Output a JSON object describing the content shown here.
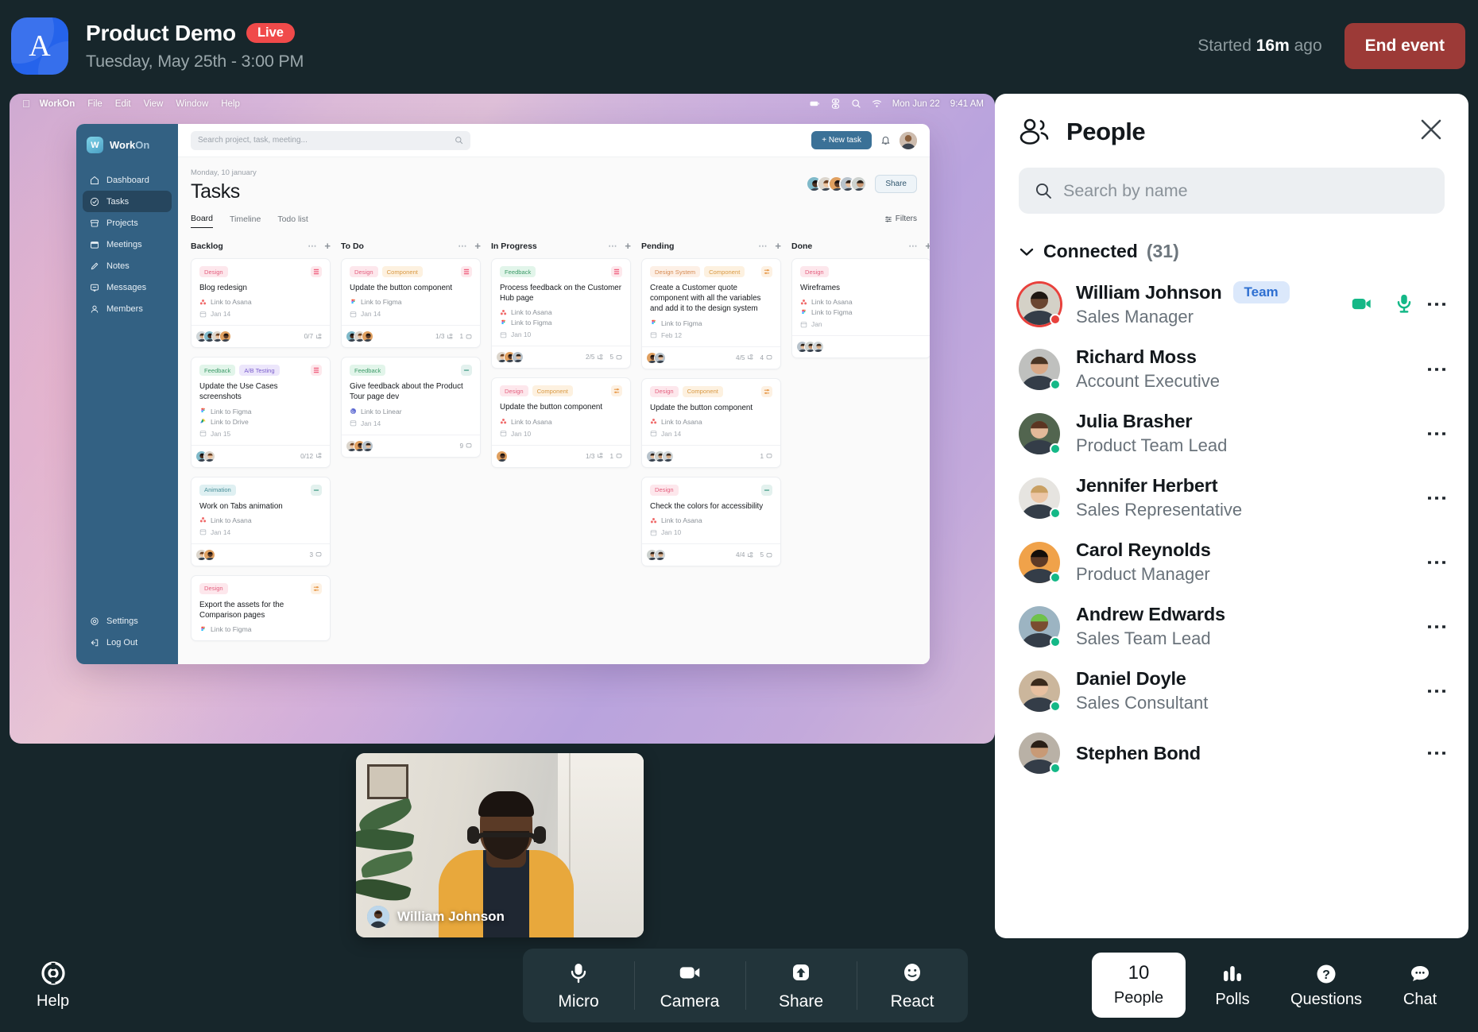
{
  "header": {
    "logo_letter": "A",
    "title": "Product Demo",
    "live_badge": "Live",
    "date": "Tuesday, May 25th - 3:00 PM",
    "started_prefix": "Started ",
    "started_value": "16m",
    "started_suffix": " ago",
    "end_event_label": "End event",
    "accent_red": "#9c3a37",
    "live_red": "#f04a4a"
  },
  "shared_screen": {
    "menubar": {
      "apple": "apple-icon",
      "app": "WorkOn",
      "items": [
        "File",
        "Edit",
        "View",
        "Window",
        "Help"
      ],
      "date": "Mon Jun 22",
      "time": "9:41 AM"
    },
    "app": {
      "brand_a": "Work",
      "brand_b": "On",
      "brand_mark": "W",
      "search_placeholder": "Search project, task, meeting...",
      "new_task_label": "+ New task",
      "nav": [
        {
          "label": "Dashboard",
          "icon": "home-icon",
          "active": false
        },
        {
          "label": "Tasks",
          "icon": "check-circle-icon",
          "active": true
        },
        {
          "label": "Projects",
          "icon": "archive-icon",
          "active": false
        },
        {
          "label": "Meetings",
          "icon": "calendar-icon",
          "active": false
        },
        {
          "label": "Notes",
          "icon": "pencil-icon",
          "active": false
        },
        {
          "label": "Messages",
          "icon": "message-icon",
          "active": false
        },
        {
          "label": "Members",
          "icon": "user-icon",
          "active": false
        }
      ],
      "nav_bottom": [
        {
          "label": "Settings",
          "icon": "gear-icon"
        },
        {
          "label": "Log Out",
          "icon": "logout-icon"
        }
      ],
      "date_line": "Monday, 10 january",
      "page_title": "Tasks",
      "share_label": "Share",
      "filters_label": "Filters",
      "tabs": [
        {
          "label": "Board",
          "active": true
        },
        {
          "label": "Timeline",
          "active": false
        },
        {
          "label": "Todo list",
          "active": false
        }
      ],
      "columns": [
        {
          "name": "Backlog",
          "cards": [
            {
              "tags": [
                {
                  "label": "Design",
                  "kind": "design"
                }
              ],
              "priority": "high",
              "title": "Blog redesign",
              "links": [
                {
                  "label": "Link to Asana",
                  "icon": "asana-icon"
                }
              ],
              "date": "Jan 14",
              "avatars": 4,
              "subtasks": "0/7",
              "comments": ""
            },
            {
              "tags": [
                {
                  "label": "Feedback",
                  "kind": "feedback"
                },
                {
                  "label": "A/B Testing",
                  "kind": "ab"
                }
              ],
              "priority": "high",
              "title": "Update the Use Cases screenshots",
              "links": [
                {
                  "label": "Link to Figma",
                  "icon": "figma-icon"
                },
                {
                  "label": "Link to Drive",
                  "icon": "drive-icon"
                }
              ],
              "date": "Jan 15",
              "avatars": 2,
              "subtasks": "0/12",
              "comments": ""
            },
            {
              "tags": [
                {
                  "label": "Animation",
                  "kind": "anim"
                }
              ],
              "priority": "low",
              "title": "Work on Tabs animation",
              "links": [
                {
                  "label": "Link to Asana",
                  "icon": "asana-icon"
                }
              ],
              "date": "Jan 14",
              "avatars": 2,
              "subtasks": "",
              "comments": "3"
            },
            {
              "tags": [
                {
                  "label": "Design",
                  "kind": "design"
                }
              ],
              "priority": "med",
              "title": "Export the assets for the Comparison pages",
              "links": [
                {
                  "label": "Link to Figma",
                  "icon": "figma-icon"
                }
              ],
              "date": "",
              "avatars": 0,
              "subtasks": "",
              "comments": ""
            }
          ]
        },
        {
          "name": "To Do",
          "cards": [
            {
              "tags": [
                {
                  "label": "Design",
                  "kind": "design"
                },
                {
                  "label": "Component",
                  "kind": "component"
                }
              ],
              "priority": "high",
              "title": "Update the button component",
              "links": [
                {
                  "label": "Link to Figma",
                  "icon": "figma-icon"
                }
              ],
              "date": "Jan 14",
              "avatars": 3,
              "subtasks": "1/3",
              "comments": "1"
            },
            {
              "tags": [
                {
                  "label": "Feedback",
                  "kind": "feedback"
                }
              ],
              "priority": "low",
              "title": "Give feedback about the Product Tour page dev",
              "links": [
                {
                  "label": "Link to Linear",
                  "icon": "linear-icon"
                }
              ],
              "date": "Jan 14",
              "avatars": 3,
              "subtasks": "",
              "comments": "9"
            }
          ]
        },
        {
          "name": "In Progress",
          "cards": [
            {
              "tags": [
                {
                  "label": "Feedback",
                  "kind": "feedback"
                }
              ],
              "priority": "high",
              "title": "Process feedback on the Customer Hub page",
              "links": [
                {
                  "label": "Link to Asana",
                  "icon": "asana-icon"
                },
                {
                  "label": "Link to Figma",
                  "icon": "figma-icon"
                }
              ],
              "date": "Jan 10",
              "avatars": 3,
              "subtasks": "2/5",
              "comments": "5"
            },
            {
              "tags": [
                {
                  "label": "Design",
                  "kind": "design"
                },
                {
                  "label": "Component",
                  "kind": "component"
                }
              ],
              "priority": "med",
              "title": "Update the button component",
              "links": [
                {
                  "label": "Link to Asana",
                  "icon": "asana-icon"
                }
              ],
              "date": "Jan 10",
              "avatars": 1,
              "subtasks": "1/3",
              "comments": "1"
            }
          ]
        },
        {
          "name": "Pending",
          "cards": [
            {
              "tags": [
                {
                  "label": "Design System",
                  "kind": "ds"
                },
                {
                  "label": "Component",
                  "kind": "component"
                }
              ],
              "priority": "med",
              "title": "Create a Customer quote component with all the variables and add it to the design system",
              "links": [
                {
                  "label": "Link to Figma",
                  "icon": "figma-icon"
                }
              ],
              "date": "Feb 12",
              "avatars": 2,
              "subtasks": "4/5",
              "comments": "4"
            },
            {
              "tags": [
                {
                  "label": "Design",
                  "kind": "design"
                },
                {
                  "label": "Component",
                  "kind": "component"
                }
              ],
              "priority": "med",
              "title": "Update the button component",
              "links": [
                {
                  "label": "Link to Asana",
                  "icon": "asana-icon"
                }
              ],
              "date": "Jan 14",
              "avatars": 3,
              "subtasks": "",
              "comments": "1"
            },
            {
              "tags": [
                {
                  "label": "Design",
                  "kind": "design"
                }
              ],
              "priority": "low",
              "title": "Check the colors for accessibility",
              "links": [
                {
                  "label": "Link to Asana",
                  "icon": "asana-icon"
                }
              ],
              "date": "Jan 10",
              "avatars": 2,
              "subtasks": "4/4",
              "comments": "5"
            }
          ]
        },
        {
          "name": "Done",
          "cards": [
            {
              "tags": [
                {
                  "label": "Design",
                  "kind": "design"
                }
              ],
              "priority": "",
              "title": "Wireframes",
              "links": [
                {
                  "label": "Link to Asana",
                  "icon": "asana-icon"
                },
                {
                  "label": "Link to Figma",
                  "icon": "figma-icon"
                }
              ],
              "date": "Jan",
              "avatars": 3,
              "subtasks": "",
              "comments": ""
            }
          ]
        }
      ]
    }
  },
  "self_video": {
    "name": "William Johnson"
  },
  "people_panel": {
    "title": "People",
    "search_placeholder": "Search by name",
    "search_value": "",
    "group_label": "Connected",
    "group_count": "(31)",
    "team_badge": "Team",
    "people": [
      {
        "name": "William Johnson",
        "role": "Sales Manager",
        "badge": "Team",
        "status": "red",
        "speaking": true,
        "camera_on": true,
        "mic_on": true,
        "skin": "#6a4631",
        "hair": "#1e1712",
        "bg": "#d4d1c7"
      },
      {
        "name": "Richard Moss",
        "role": "Account Executive",
        "badge": "",
        "status": "green",
        "speaking": false,
        "camera_on": false,
        "mic_on": false,
        "skin": "#d9a886",
        "hair": "#4a3524",
        "bg": "#bfc0be"
      },
      {
        "name": "Julia Brasher",
        "role": "Product Team Lead",
        "badge": "",
        "status": "green",
        "speaking": false,
        "camera_on": false,
        "mic_on": false,
        "skin": "#e2b999",
        "hair": "#5b3522",
        "bg": "#52654f"
      },
      {
        "name": "Jennifer Herbert",
        "role": "Sales Representative",
        "badge": "",
        "status": "green",
        "speaking": false,
        "camera_on": false,
        "mic_on": false,
        "skin": "#ecc6a6",
        "hair": "#c9a063",
        "bg": "#e6e4e0"
      },
      {
        "name": "Carol Reynolds",
        "role": "Product Manager",
        "badge": "",
        "status": "green",
        "speaking": false,
        "camera_on": false,
        "mic_on": false,
        "skin": "#5e3a26",
        "hair": "#140e0a",
        "bg": "#f0a24a"
      },
      {
        "name": "Andrew Edwards",
        "role": "Sales Team Lead",
        "badge": "",
        "status": "green",
        "speaking": false,
        "camera_on": false,
        "mic_on": false,
        "skin": "#7a4d30",
        "hair": "#6fc24a",
        "bg": "#9cb4c2"
      },
      {
        "name": "Daniel Doyle",
        "role": "Sales Consultant",
        "badge": "",
        "status": "green",
        "speaking": false,
        "camera_on": false,
        "mic_on": false,
        "skin": "#e8c0a0",
        "hair": "#3a2a1c",
        "bg": "#cbb69c"
      },
      {
        "name": "Stephen Bond",
        "role": "",
        "badge": "",
        "status": "green",
        "speaking": false,
        "camera_on": false,
        "mic_on": false,
        "skin": "#c89a76",
        "hair": "#2a1f16",
        "bg": "#b9b1a6"
      }
    ],
    "status_green": "#14b887",
    "status_red": "#e8413c"
  },
  "bottom_bar": {
    "help_label": "Help",
    "controls": [
      {
        "label": "Micro",
        "icon": "microphone-icon"
      },
      {
        "label": "Camera",
        "icon": "video-camera-icon"
      },
      {
        "label": "Share",
        "icon": "share-screen-icon"
      },
      {
        "label": "React",
        "icon": "smiley-icon"
      }
    ],
    "right_controls": [
      {
        "label": "People",
        "num": "10",
        "icon": "",
        "active": true
      },
      {
        "label": "Polls",
        "num": "",
        "icon": "bar-chart-icon",
        "active": false
      },
      {
        "label": "Questions",
        "num": "",
        "icon": "question-mark-icon",
        "active": false
      },
      {
        "label": "Chat",
        "num": "",
        "icon": "chat-bubble-icon",
        "active": false
      }
    ]
  }
}
